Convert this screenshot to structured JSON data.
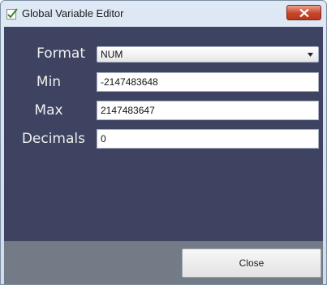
{
  "window": {
    "title": "Global Variable Editor"
  },
  "icons": {
    "app": "checklist-icon",
    "close": "close-x-icon",
    "dropdown": "chevron-down-icon"
  },
  "colors": {
    "client_bg": "#3e4361",
    "footer_bg": "#727b86",
    "close_button": "#c7452a"
  },
  "fields": {
    "format": {
      "label": "Format",
      "value": "NUM"
    },
    "min": {
      "label": "Min",
      "value": "-2147483648"
    },
    "max": {
      "label": "Max",
      "value": "2147483647"
    },
    "decimals": {
      "label": "Decimals",
      "value": "0"
    }
  },
  "footer": {
    "close_label": "Close"
  }
}
